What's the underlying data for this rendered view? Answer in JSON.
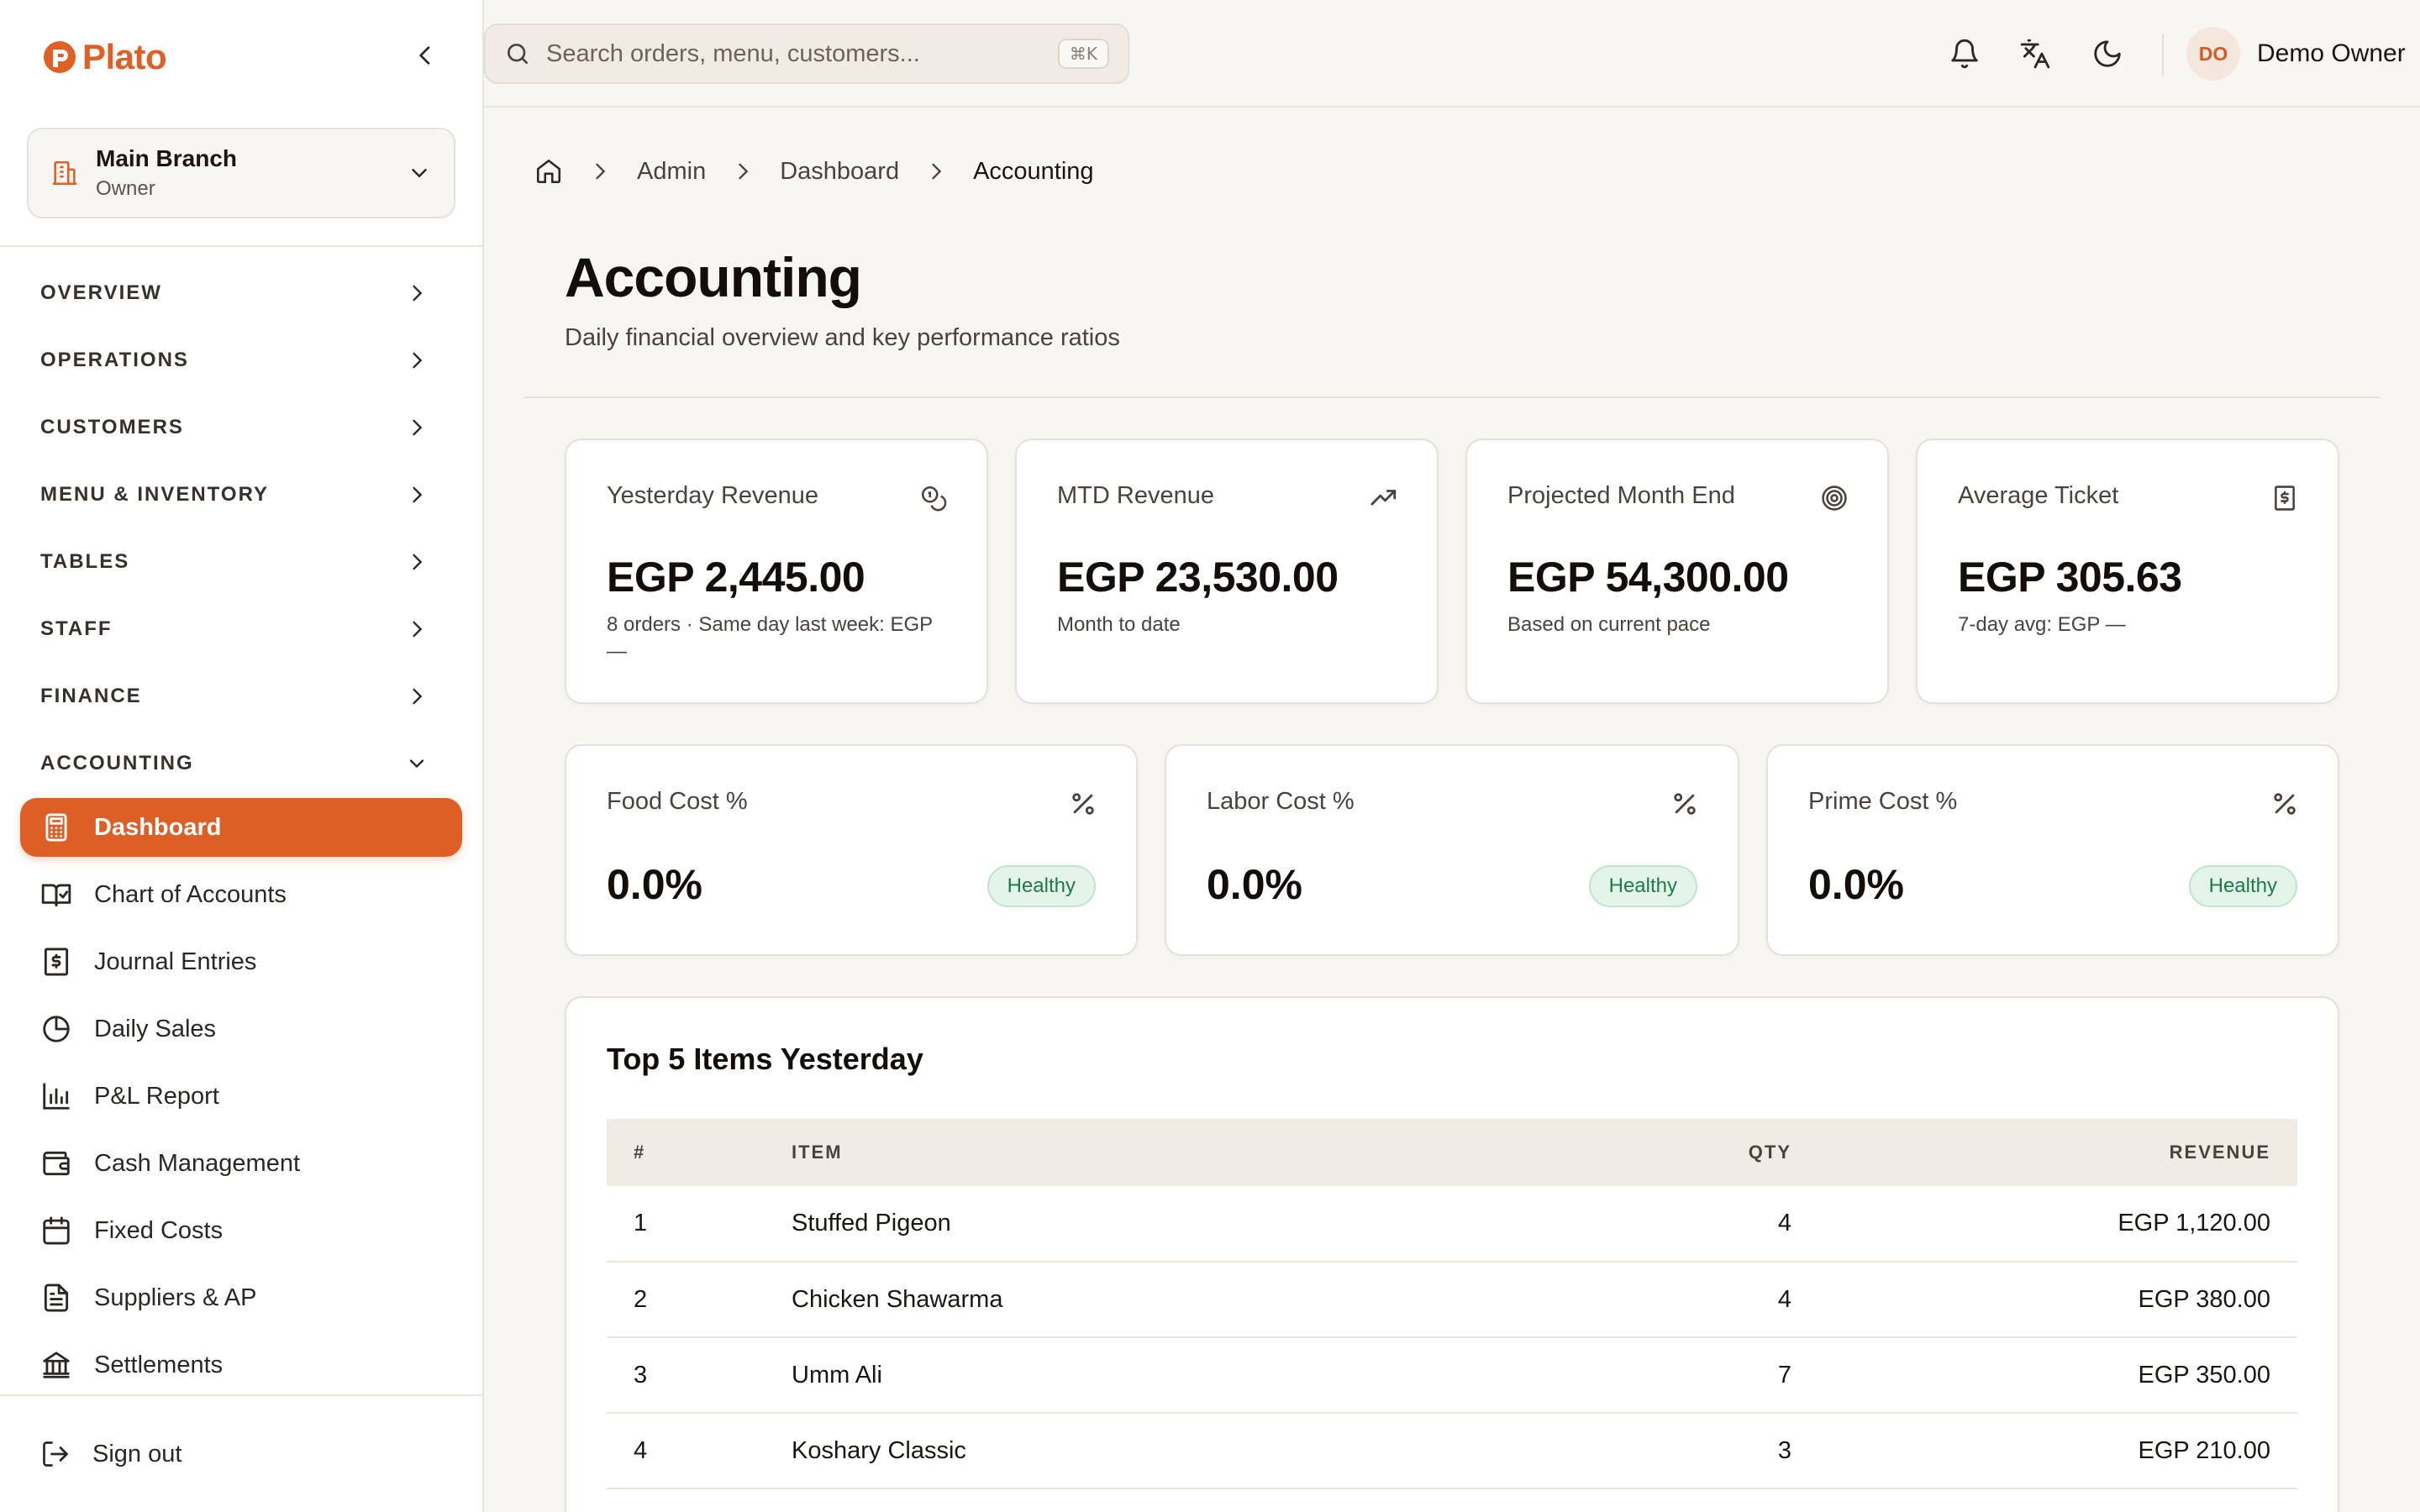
{
  "app": {
    "name": "Plato"
  },
  "branch": {
    "name": "Main Branch",
    "role": "Owner"
  },
  "nav": {
    "sections": [
      {
        "label": "OVERVIEW"
      },
      {
        "label": "OPERATIONS"
      },
      {
        "label": "CUSTOMERS"
      },
      {
        "label": "MENU & INVENTORY"
      },
      {
        "label": "TABLES"
      },
      {
        "label": "STAFF"
      },
      {
        "label": "FINANCE"
      },
      {
        "label": "ACCOUNTING"
      }
    ],
    "accounting_items": [
      {
        "label": "Dashboard",
        "icon": "calculator-icon",
        "active": true
      },
      {
        "label": "Chart of Accounts",
        "icon": "book-check-icon"
      },
      {
        "label": "Journal Entries",
        "icon": "receipt-icon"
      },
      {
        "label": "Daily Sales",
        "icon": "pie-chart-icon"
      },
      {
        "label": "P&L Report",
        "icon": "bar-chart-icon"
      },
      {
        "label": "Cash Management",
        "icon": "wallet-icon"
      },
      {
        "label": "Fixed Costs",
        "icon": "calendar-icon"
      },
      {
        "label": "Suppliers & AP",
        "icon": "file-text-icon"
      },
      {
        "label": "Settlements",
        "icon": "bank-icon"
      }
    ],
    "signout": "Sign out"
  },
  "search": {
    "placeholder": "Search orders, menu, customers...",
    "shortcut": "⌘K",
    "value": ""
  },
  "user": {
    "initials": "DO",
    "name": "Demo Owner"
  },
  "breadcrumb": {
    "items": [
      "Admin",
      "Dashboard"
    ],
    "current": "Accounting"
  },
  "page": {
    "title": "Accounting",
    "subtitle": "Daily financial overview and key performance ratios"
  },
  "kpis": [
    {
      "label": "Yesterday Revenue",
      "value": "EGP 2,445.00",
      "sub": "8 orders · Same day last week: EGP —",
      "icon": "coins-icon"
    },
    {
      "label": "MTD Revenue",
      "value": "EGP 23,530.00",
      "sub": "Month to date",
      "icon": "trending-up-icon"
    },
    {
      "label": "Projected Month End",
      "value": "EGP 54,300.00",
      "sub": "Based on current pace",
      "icon": "target-icon"
    },
    {
      "label": "Average Ticket",
      "value": "EGP 305.63",
      "sub": "7-day avg: EGP —",
      "icon": "dollar-receipt-icon"
    }
  ],
  "ratios": [
    {
      "label": "Food Cost %",
      "value": "0.0%",
      "status": "Healthy",
      "icon": "percent-icon"
    },
    {
      "label": "Labor Cost %",
      "value": "0.0%",
      "status": "Healthy",
      "icon": "percent-icon"
    },
    {
      "label": "Prime Cost %",
      "value": "0.0%",
      "status": "Healthy",
      "icon": "percent-icon"
    }
  ],
  "top_items": {
    "title": "Top 5 Items Yesterday",
    "columns": [
      "#",
      "ITEM",
      "QTY",
      "REVENUE"
    ],
    "rows": [
      {
        "rank": "1",
        "item": "Stuffed Pigeon",
        "qty": "4",
        "revenue": "EGP 1,120.00"
      },
      {
        "rank": "2",
        "item": "Chicken Shawarma",
        "qty": "4",
        "revenue": "EGP 380.00"
      },
      {
        "rank": "3",
        "item": "Umm Ali",
        "qty": "7",
        "revenue": "EGP 350.00"
      },
      {
        "rank": "4",
        "item": "Koshary Classic",
        "qty": "3",
        "revenue": "EGP 210.00"
      }
    ]
  },
  "colors": {
    "accent": "#dd5f26",
    "healthy_bg": "#e3f5ea",
    "healthy_text": "#1f7a45",
    "background": "#f8f6f3"
  }
}
